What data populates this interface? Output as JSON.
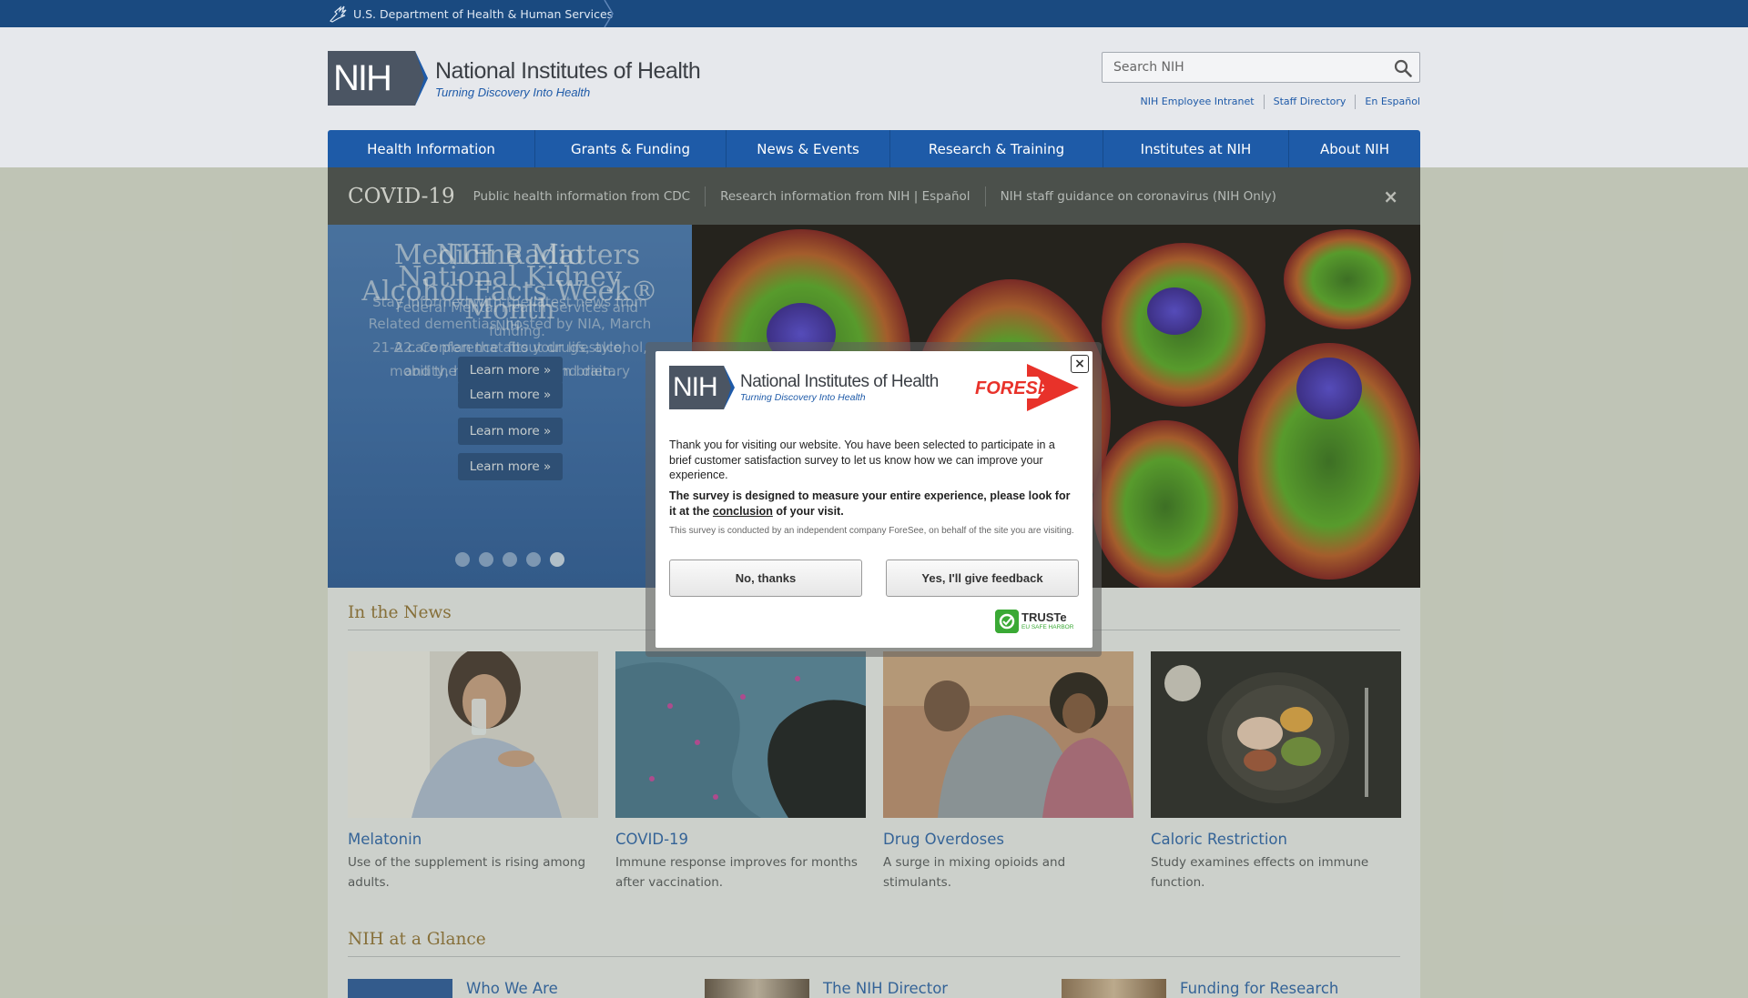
{
  "hhs": {
    "label": "U.S. Department of Health & Human Services"
  },
  "header": {
    "logo_abbrev": "NIH",
    "logo_title": "National Institutes of Health",
    "logo_tagline": "Turning Discovery Into Health",
    "search_placeholder": "Search NIH",
    "util_links": [
      "NIH Employee Intranet",
      "Staff Directory",
      "En Español"
    ]
  },
  "nav": {
    "items": [
      {
        "label": "Health Information"
      },
      {
        "label": "Grants & Funding"
      },
      {
        "label": "News & Events"
      },
      {
        "label": "Research & Training"
      },
      {
        "label": "Institutes at NIH"
      },
      {
        "label": "About NIH"
      }
    ]
  },
  "covid": {
    "title": "COVID-19",
    "links": [
      "Public health information from CDC",
      "Research information from NIH | Español",
      "NIH staff guidance on coronavirus (NIH Only)"
    ],
    "close": "×"
  },
  "carousel": {
    "slides": [
      {
        "title": "NIH Radio",
        "text": "Stay informed with the latest news from NIH.",
        "button": "Learn more »"
      },
      {
        "title": "Medicine Matters",
        "text": "Federal Mental Health Services and funding.",
        "button": "Learn more »"
      },
      {
        "title": "National Kidney Month",
        "text": "A care plan that fits your lifestyle, mobility, health status, and dietary needs.",
        "button": "Learn more »"
      },
      {
        "title": "Alcohol Facts Week®",
        "text": "Related dementias, hosted by NIA, March 21-22. Conference about drugs, alcohol, and the developing teen brain.",
        "button": "Learn more »"
      }
    ],
    "dots": 5,
    "active_dot": 4
  },
  "news": {
    "title": "In the News",
    "items": [
      {
        "title": "Melatonin",
        "desc": "Use of the supplement is rising among adults."
      },
      {
        "title": "COVID-19",
        "desc": "Immune response improves for months after vaccination."
      },
      {
        "title": "Drug Overdoses",
        "desc": "A surge in mixing opioids and stimulants."
      },
      {
        "title": "Caloric Restriction",
        "desc": "Study examines effects on immune function."
      }
    ]
  },
  "glance": {
    "title": "NIH at a Glance",
    "items": [
      {
        "title": "Who We Are"
      },
      {
        "title": "The NIH Director"
      },
      {
        "title": "Funding for Research"
      }
    ]
  },
  "modal": {
    "close": "×",
    "logo_abbrev": "NIH",
    "logo_title": "National Institutes of Health",
    "logo_tagline": "Turning Discovery Into Health",
    "brand": "FORESEE",
    "p1": "Thank you for visiting our website. You have been selected to participate in a brief customer satisfaction survey to let us know how we can improve your experience.",
    "p2_before": "The survey is designed to measure your entire experience, please look for it at the ",
    "p2_link": "conclusion",
    "p2_after": " of your visit.",
    "p3": "This survey is conducted by an independent company ForeSee, on behalf of the site you are visiting.",
    "btn_no": "No, thanks",
    "btn_yes": "Yes, I'll give feedback",
    "truste_name": "TRUSTe",
    "truste_sub": "EU SAFE HARBOR"
  },
  "colors": {
    "brand_blue": "#1e5ba8",
    "section_gold": "#8b6a2b",
    "hhs_bar": "#1a4a80"
  }
}
